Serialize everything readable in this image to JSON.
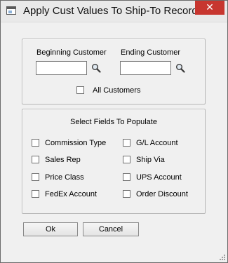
{
  "window": {
    "title": "Apply Cust Values To Ship-To Record",
    "close_glyph": "✕"
  },
  "customer_range": {
    "beginning_label": "Beginning Customer",
    "ending_label": "Ending Customer",
    "beginning_value": "",
    "ending_value": "",
    "all_customers_label": "All Customers",
    "all_customers_checked": false
  },
  "fields_group": {
    "heading": "Select Fields To Populate",
    "left": [
      {
        "label": "Commission Type",
        "checked": false
      },
      {
        "label": "Sales Rep",
        "checked": false
      },
      {
        "label": "Price Class",
        "checked": false
      },
      {
        "label": "FedEx Account",
        "checked": false
      }
    ],
    "right": [
      {
        "label": "G/L Account",
        "checked": false
      },
      {
        "label": "Ship Via",
        "checked": false
      },
      {
        "label": "UPS Account",
        "checked": false
      },
      {
        "label": "Order Discount",
        "checked": false
      }
    ]
  },
  "buttons": {
    "ok": "Ok",
    "cancel": "Cancel"
  },
  "colors": {
    "close": "#c7362f",
    "background": "#f0f0f0",
    "border": "#b5b5b5"
  }
}
